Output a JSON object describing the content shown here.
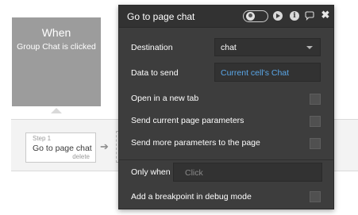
{
  "event": {
    "title": "When",
    "subtitle": "Group Chat is clicked"
  },
  "step": {
    "number": "Step 1",
    "name": "Go to page chat",
    "delete_label": "delete",
    "arrow": "➔"
  },
  "panel": {
    "title": "Go to page chat",
    "close_glyph": "✖",
    "comment_glyph": "💬",
    "info_glyph": "i",
    "destination": {
      "label": "Destination",
      "value": "chat"
    },
    "data_to_send": {
      "label": "Data to send",
      "value": "Current cell's Chat"
    },
    "open_new_tab": {
      "label": "Open in a new tab",
      "checked": false
    },
    "send_current_params": {
      "label": "Send current page parameters",
      "checked": false
    },
    "send_more_params": {
      "label": "Send more parameters to the page",
      "checked": false
    },
    "only_when": {
      "label": "Only when",
      "placeholder": "Click"
    },
    "breakpoint": {
      "label": "Add a breakpoint in debug mode",
      "checked": false
    }
  },
  "colors": {
    "panel_bg": "#3d3d3d",
    "header_bg": "#323232",
    "field_bg": "#323232",
    "link_blue": "#5aa7e8",
    "event_block": "#9c9c9c"
  }
}
